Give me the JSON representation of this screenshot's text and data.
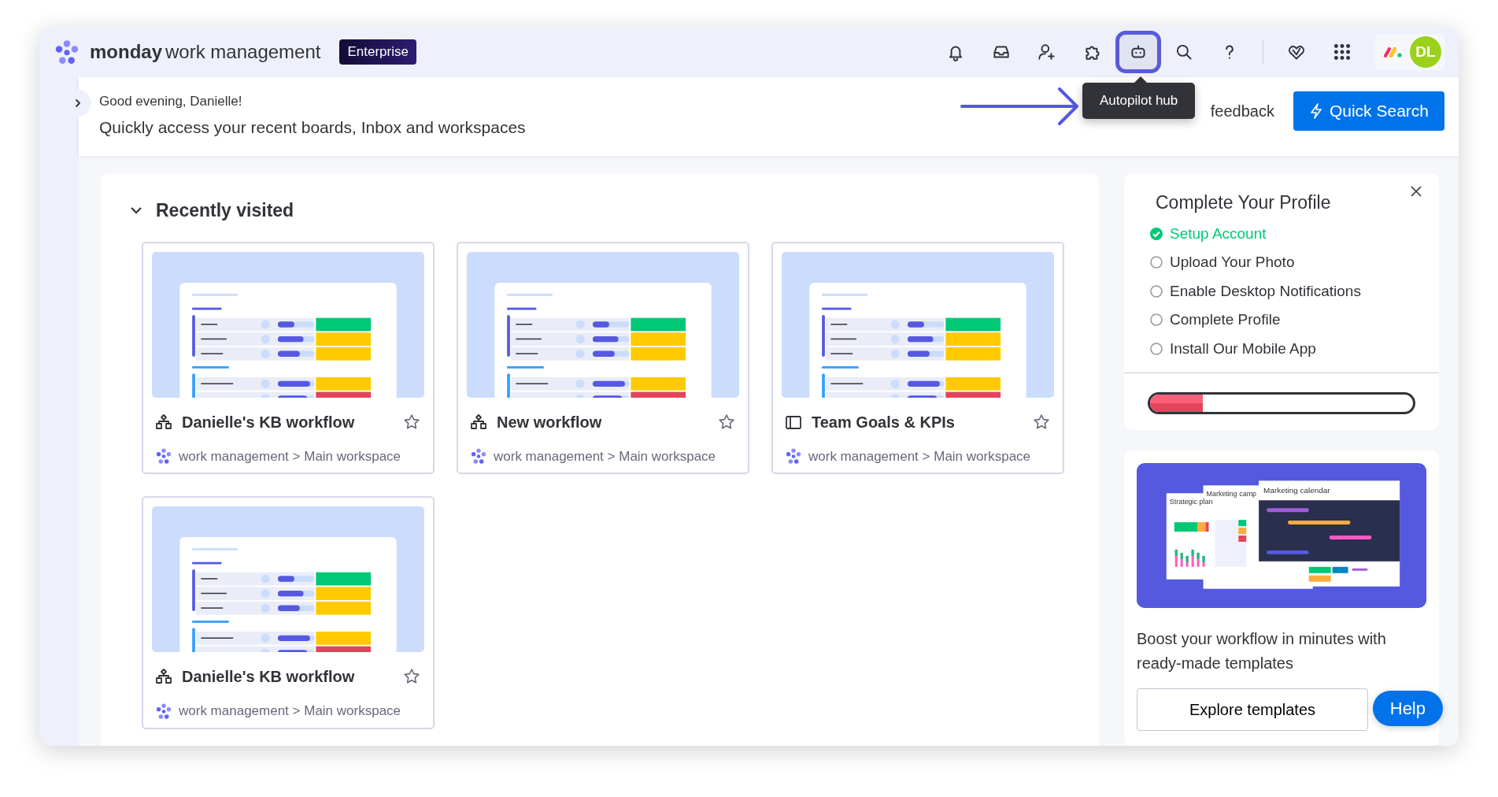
{
  "header": {
    "brand": "monday",
    "product": "work management",
    "plan_badge": "Enterprise",
    "toolbar": [
      {
        "kind": "bell",
        "selected": false
      },
      {
        "kind": "inbox",
        "selected": false
      },
      {
        "kind": "invite",
        "selected": false
      },
      {
        "kind": "puzzle",
        "selected": false
      },
      {
        "kind": "robot",
        "selected": true
      },
      {
        "kind": "search",
        "selected": false
      },
      {
        "kind": "help",
        "selected": false
      },
      {
        "kind": "heart",
        "selected": false
      },
      {
        "kind": "apps",
        "selected": false
      }
    ],
    "avatar": "DL"
  },
  "tooltip": "Autopilot hub",
  "greeting": {
    "title": "Good evening, Danielle!",
    "subtitle": "Quickly access your recent boards, Inbox and workspaces",
    "feedback_link": "feedback",
    "quick_search_button": "Quick Search"
  },
  "recently_visited": {
    "title": "Recently visited",
    "expanded": true,
    "boards": [
      {
        "name": "Danielle's KB workflow",
        "kind": "workflow",
        "starred": false,
        "path": "work management > Main workspace"
      },
      {
        "name": "New workflow",
        "kind": "workflow",
        "starred": false,
        "path": "work management > Main workspace"
      },
      {
        "name": "Team Goals & KPIs",
        "kind": "board",
        "starred": false,
        "path": "work management > Main workspace"
      },
      {
        "name": "Danielle's KB workflow",
        "kind": "workflow",
        "starred": false,
        "path": "work management > Main workspace"
      }
    ]
  },
  "profile": {
    "title": "Complete Your Profile",
    "tasks": [
      {
        "label": "Setup Account",
        "done": true
      },
      {
        "label": "Upload Your Photo",
        "done": false
      },
      {
        "label": "Enable Desktop Notifications",
        "done": false
      },
      {
        "label": "Complete Profile",
        "done": false
      },
      {
        "label": "Install Our Mobile App",
        "done": false
      }
    ],
    "level": 0.2
  },
  "templates": {
    "preview_titles": [
      "Strategic plan",
      "Marketing camp",
      "Marketing calendar"
    ],
    "text": "Boost your workflow in minutes with ready-made templates",
    "button": "Explore templates"
  },
  "help_button": "Help"
}
